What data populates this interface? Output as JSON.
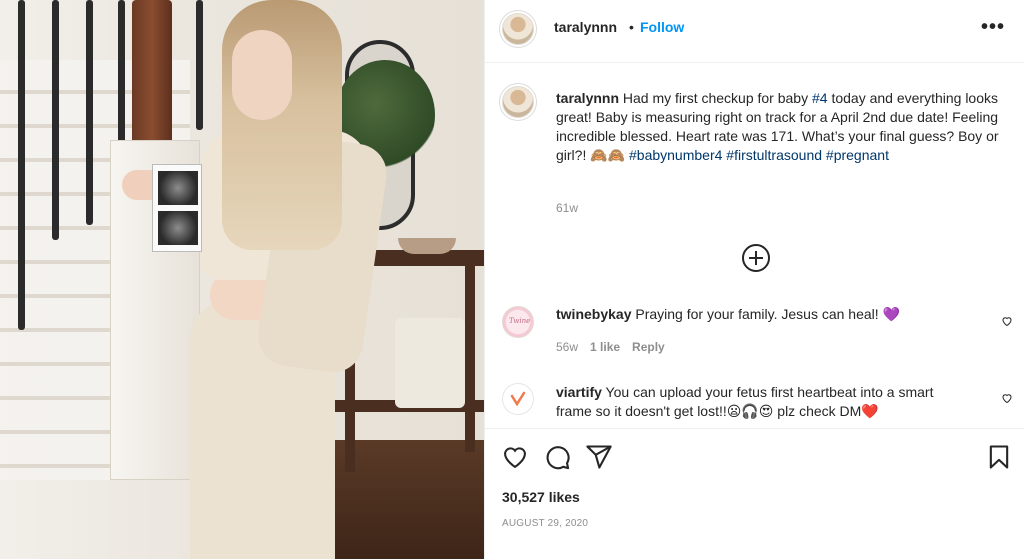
{
  "post": {
    "username": "taralynnn",
    "separator": "•",
    "follow_label": "Follow",
    "more_label": "•••"
  },
  "caption": {
    "username": "taralynnn",
    "text_1": " Had my first checkup for baby ",
    "tag_1": "#4",
    "text_2": " today and everything looks great! Baby is measuring right on track for a April 2nd due date! Feeling incredible blessed. Heart rate was 171. What’s your final guess? Boy or girl?! ",
    "emojis": "🙈🙈",
    "tags": [
      "#babynumber4",
      "#firstultrasound",
      "#pregnant"
    ],
    "time": "61w"
  },
  "comments": [
    {
      "username": "twinebykay",
      "text": " Praying for your family. Jesus can heal! ",
      "emoji": "💜",
      "time": "56w",
      "likes": "1 like",
      "reply": "Reply"
    },
    {
      "username": "viartify",
      "text": " You can upload your fetus first heartbeat into a smart frame so it doesn't get lost!!",
      "emojis": "😦🎧😍",
      "text_end": " plz check DM",
      "emoji_end": "❤️"
    }
  ],
  "likes_count": "30,527 likes",
  "date": "AUGUST 29, 2020",
  "icons": [
    "heart-icon",
    "comment-icon",
    "share-icon",
    "bookmark-icon",
    "plus-circle-icon",
    "more-icon"
  ]
}
